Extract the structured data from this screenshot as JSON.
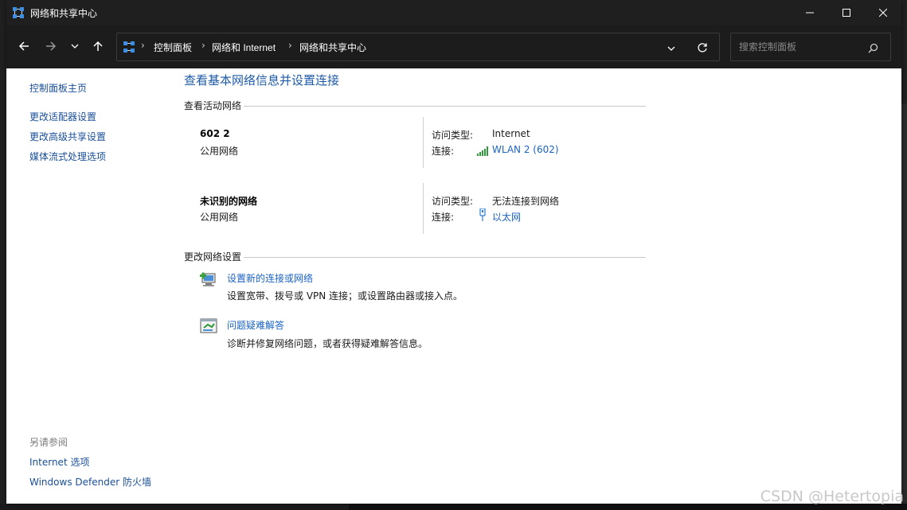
{
  "window": {
    "title": "网络和共享中心"
  },
  "address_bar": {
    "crumbs": [
      "控制面板",
      "网络和 Internet",
      "网络和共享中心"
    ],
    "separator": "›"
  },
  "search": {
    "placeholder": "搜索控制面板"
  },
  "sidebar": {
    "home": "控制面板主页",
    "items": [
      "更改适配器设置",
      "更改高级共享设置",
      "媒体流式处理选项"
    ],
    "see_also_title": "另请参阅",
    "see_also": [
      "Internet 选项",
      "Windows Defender 防火墙"
    ]
  },
  "main": {
    "heading": "查看基本网络信息并设置连接",
    "active_section": "查看活动网络",
    "networks": [
      {
        "name": "602 2",
        "type": "公用网络",
        "access_label": "访问类型:",
        "access_value": "Internet",
        "conn_label": "连接:",
        "conn_value": "WLAN 2 (602)",
        "conn_icon": "wifi-signal-icon"
      },
      {
        "name": "未识别的网络",
        "type": "公用网络",
        "access_label": "访问类型:",
        "access_value": "无法连接到网络",
        "conn_label": "连接:",
        "conn_value": "以太网",
        "conn_icon": "ethernet-icon"
      }
    ],
    "change_section": "更改网络设置",
    "tasks": [
      {
        "link": "设置新的连接或网络",
        "desc": "设置宽带、拨号或 VPN 连接；或设置路由器或接入点。",
        "icon": "new-connection-icon"
      },
      {
        "link": "问题疑难解答",
        "desc": "诊断并修复网络问题，或者获得疑难解答信息。",
        "icon": "troubleshoot-icon"
      }
    ]
  },
  "watermark": "CSDN @Hetertopia",
  "colors": {
    "link": "#1a63c4",
    "heading": "#1e5aa8",
    "titlebar": "#1f1f1f"
  }
}
